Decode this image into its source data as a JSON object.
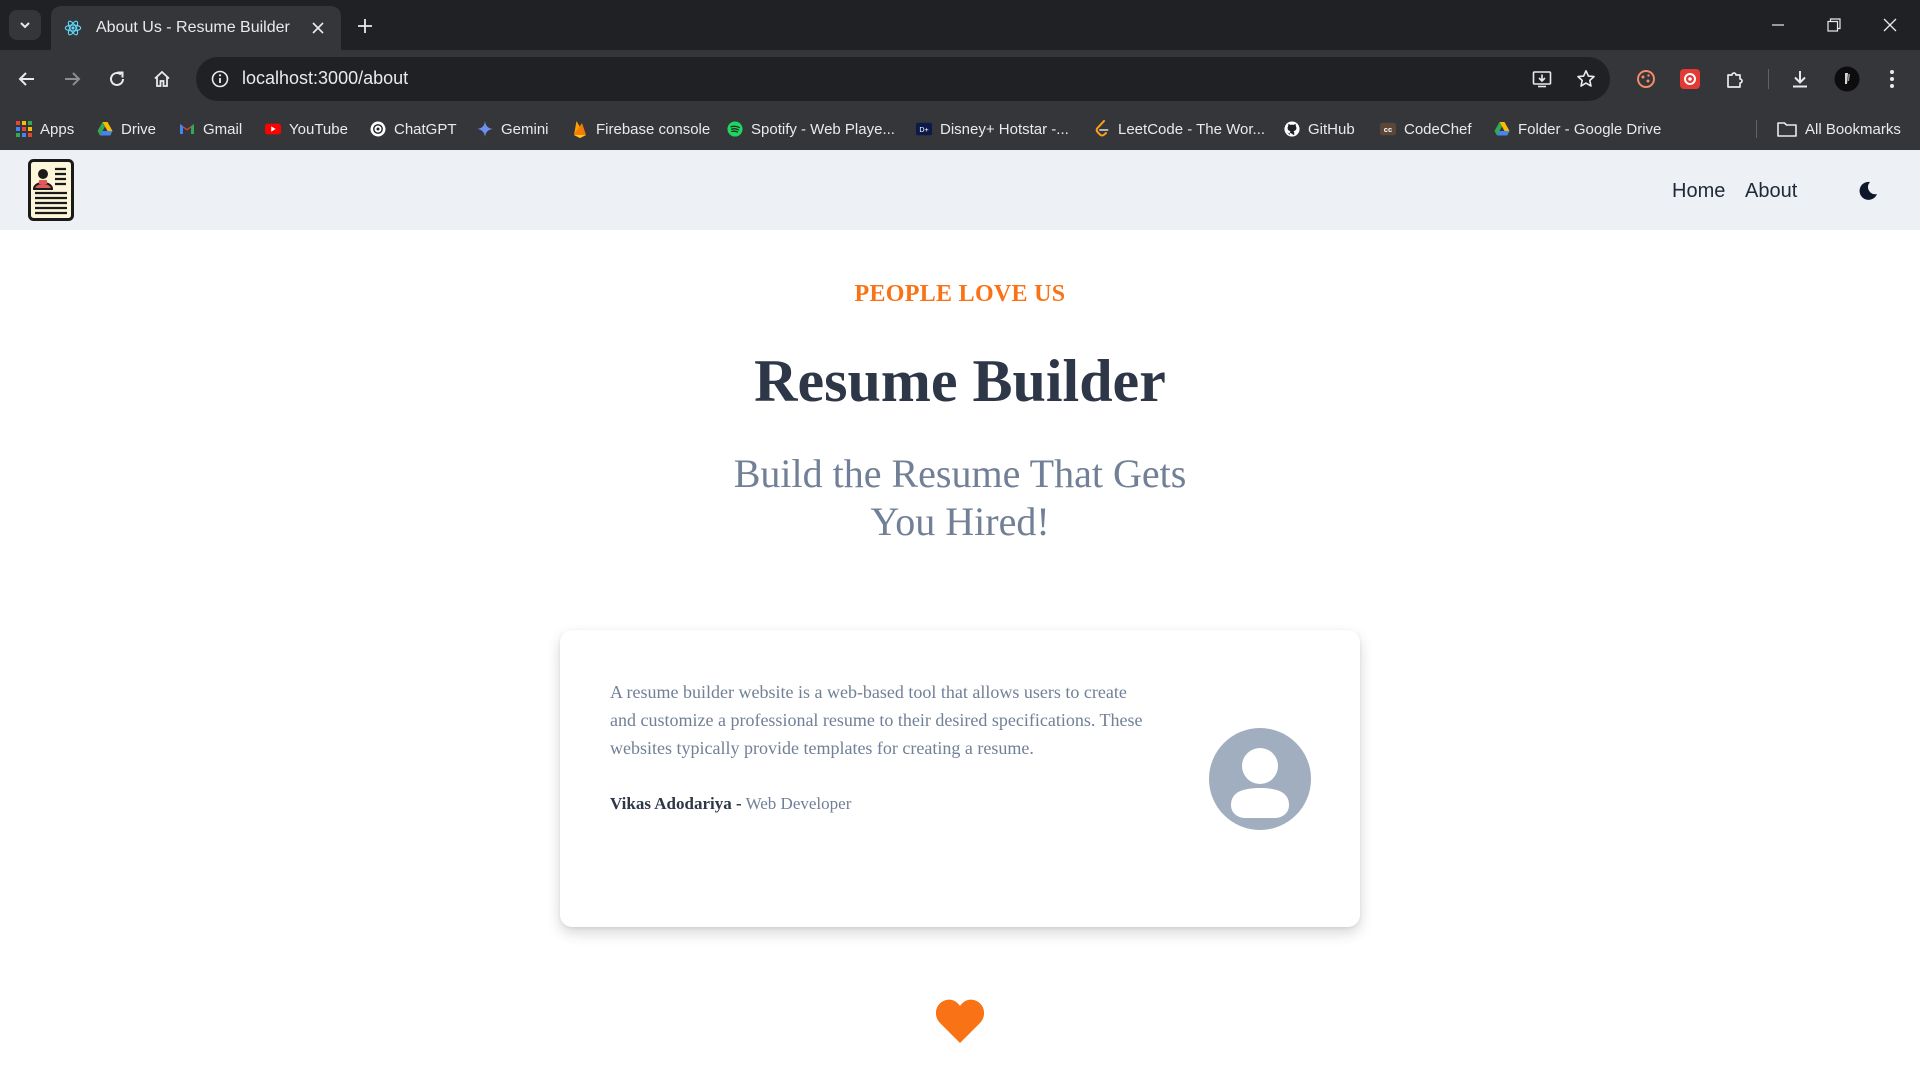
{
  "browser": {
    "tab_title": "About Us - Resume Builder",
    "url": "localhost:3000/about",
    "bookmarks": [
      {
        "label": "Apps",
        "icon": "apps-grid-icon"
      },
      {
        "label": "Drive",
        "icon": "google-drive-icon"
      },
      {
        "label": "Gmail",
        "icon": "gmail-icon"
      },
      {
        "label": "YouTube",
        "icon": "youtube-icon"
      },
      {
        "label": "ChatGPT",
        "icon": "chatgpt-icon"
      },
      {
        "label": "Gemini",
        "icon": "gemini-icon"
      },
      {
        "label": "Firebase console",
        "icon": "firebase-icon"
      },
      {
        "label": "Spotify - Web Playe...",
        "icon": "spotify-icon"
      },
      {
        "label": "Disney+ Hotstar -...",
        "icon": "hotstar-icon"
      },
      {
        "label": "LeetCode - The Wor...",
        "icon": "leetcode-icon"
      },
      {
        "label": "GitHub",
        "icon": "github-icon"
      },
      {
        "label": "CodeChef",
        "icon": "codechef-icon"
      },
      {
        "label": "Folder - Google Drive",
        "icon": "google-drive-icon"
      }
    ],
    "all_bookmarks": "All Bookmarks"
  },
  "navbar": {
    "home": "Home",
    "about": "About"
  },
  "hero": {
    "eyebrow": "PEOPLE LOVE US",
    "title": "Resume Builder",
    "subtitle": "Build the Resume That Gets You Hired!"
  },
  "testimonial": {
    "quote": "A resume builder website is a web-based tool that allows users to create and customize a professional resume to their desired specifications. These websites typically provide templates for creating a resume.",
    "author_name": "Vikas Adodariya -",
    "author_role": "Web Developer"
  },
  "colors": {
    "accent": "#f97316",
    "heading": "#2d3748",
    "muted": "#718096",
    "navbar_bg": "#edf1f5"
  }
}
